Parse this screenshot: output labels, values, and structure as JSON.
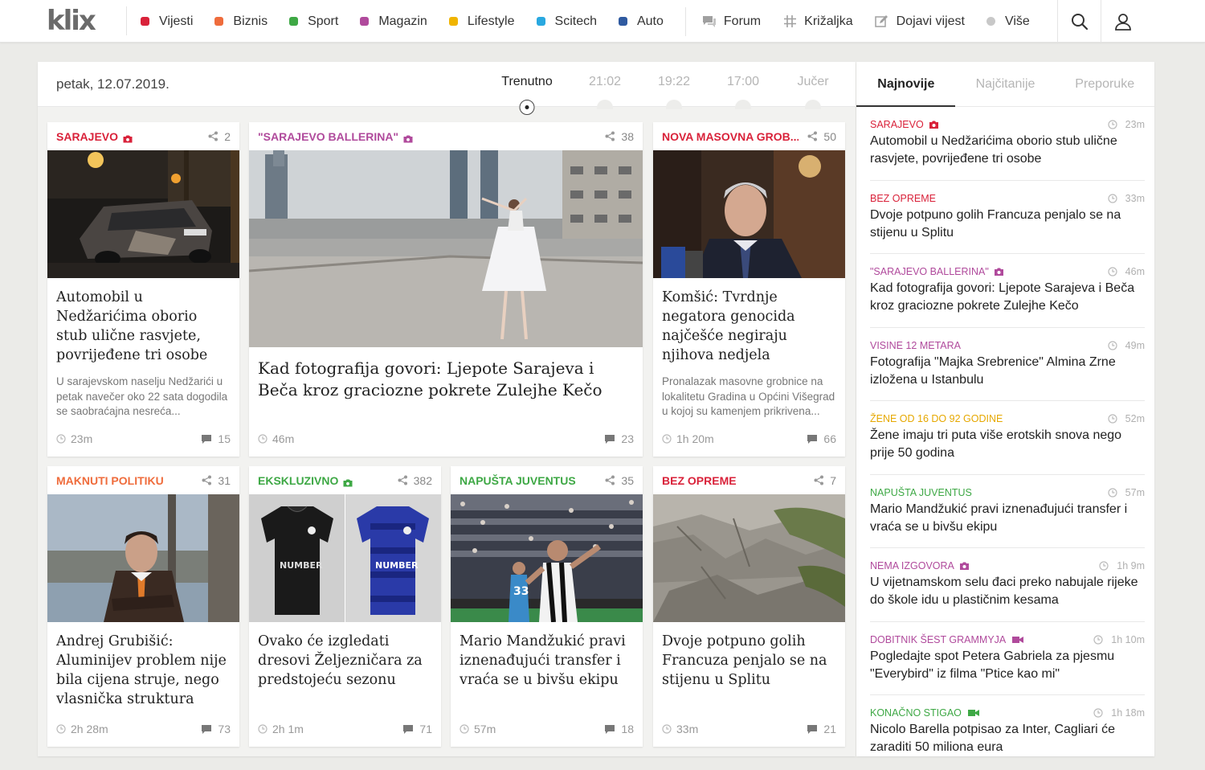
{
  "brand": {
    "name": "klix"
  },
  "nav": {
    "categories": [
      {
        "label": "Vijesti",
        "color": "#d9223a"
      },
      {
        "label": "Biznis",
        "color": "#ef6c3c"
      },
      {
        "label": "Sport",
        "color": "#3ea845"
      },
      {
        "label": "Magazin",
        "color": "#b04a9c"
      },
      {
        "label": "Lifestyle",
        "color": "#f0b400"
      },
      {
        "label": "Scitech",
        "color": "#29a8e0"
      },
      {
        "label": "Auto",
        "color": "#2f5aa0"
      }
    ],
    "forum": "Forum",
    "krizaljka": "Križaljka",
    "dojavi": "Dojavi vijest",
    "vise": "Više"
  },
  "timeline": {
    "date": "petak, 12.07.2019.",
    "items": [
      "Trenutno",
      "21:02",
      "19:22",
      "17:00",
      "Jučer"
    ]
  },
  "cards": [
    {
      "category": "SARAJEVO",
      "cat_color": "#d9223a",
      "camera": true,
      "shares": "2",
      "title": "Automobil u Nedžarićima oborio stub ulične rasvjete, povrijeđene tri osobe",
      "lead": "U sarajevskom naselju Nedžarići u petak navečer oko 22 sata dogodila se saobraćajna nesreća...",
      "time": "23m",
      "comments": "15"
    },
    {
      "category": "\"SARAJEVO BALLERINA\"",
      "cat_color": "#b04a9c",
      "camera": true,
      "shares": "38",
      "title": "Kad fotografija govori: Ljepote Sarajeva i Beča kroz graciozne pokrete Zulejhe Kečo",
      "lead": "",
      "time": "46m",
      "comments": "23"
    },
    {
      "category": "NOVA MASOVNA GROB...",
      "cat_color": "#d9223a",
      "camera": false,
      "shares": "50",
      "title": "Komšić: Tvrdnje negatora genocida najčešće negiraju njihova nedjela",
      "lead": "Pronalazak masovne grobnice na lokalitetu Gradina u Općini Višegrad u kojoj su kamenjem prikrivena...",
      "time": "1h 20m",
      "comments": "66"
    },
    {
      "category": "MAKNUTI POLITIKU",
      "cat_color": "#ef6c3c",
      "camera": false,
      "shares": "31",
      "title": "Andrej Grubišić: Aluminijev problem nije bila cijena struje, nego vlasnička struktura",
      "lead": "",
      "time": "2h 28m",
      "comments": "73"
    },
    {
      "category": "EKSKLUZIVNO",
      "cat_color": "#3ea845",
      "camera": true,
      "shares": "382",
      "title": "Ovako će izgledati dresovi Željezničara za predstojeću sezonu",
      "lead": "",
      "time": "2h 1m",
      "comments": "71"
    },
    {
      "category": "NAPUŠTA JUVENTUS",
      "cat_color": "#3ea845",
      "camera": false,
      "shares": "35",
      "title": "Mario Mandžukić pravi iznenađujući transfer i vraća se u bivšu ekipu",
      "lead": "",
      "time": "57m",
      "comments": "18"
    },
    {
      "category": "BEZ OPREME",
      "cat_color": "#d9223a",
      "camera": false,
      "shares": "7",
      "title": "Dvoje potpuno golih Francuza penjalo se na stijenu u Splitu",
      "lead": "",
      "time": "33m",
      "comments": "21"
    }
  ],
  "sidebar": {
    "tabs": [
      "Najnovije",
      "Najčitanije",
      "Preporuke"
    ],
    "items": [
      {
        "category": "SARAJEVO",
        "cat_color": "#d9223a",
        "icon": "camera",
        "time": "23m",
        "title": "Automobil u Nedžarićima oborio stub ulične rasvjete, povrijeđene tri osobe"
      },
      {
        "category": "BEZ OPREME",
        "cat_color": "#d9223a",
        "icon": "",
        "time": "33m",
        "title": "Dvoje potpuno golih Francuza penjalo se na stijenu u Splitu"
      },
      {
        "category": "\"SARAJEVO BALLERINA\"",
        "cat_color": "#b04a9c",
        "icon": "camera",
        "time": "46m",
        "title": "Kad fotografija govori: Ljepote Sarajeva i Beča kroz graciozne pokrete Zulejhe Kečo"
      },
      {
        "category": "VISINE 12 METARA",
        "cat_color": "#b04a9c",
        "icon": "",
        "time": "49m",
        "title": "Fotografija \"Majka Srebrenice\" Almina Zrne izložena u Istanbulu"
      },
      {
        "category": "ŽENE OD 16 DO 92 GODINE",
        "cat_color": "#e6a800",
        "icon": "",
        "time": "52m",
        "title": "Žene imaju tri puta više erotskih snova nego prije 50 godina"
      },
      {
        "category": "NAPUŠTA JUVENTUS",
        "cat_color": "#3ea845",
        "icon": "",
        "time": "57m",
        "title": "Mario Mandžukić pravi iznenađujući transfer i vraća se u bivšu ekipu"
      },
      {
        "category": "NEMA IZGOVORA",
        "cat_color": "#b04a9c",
        "icon": "camera",
        "time": "1h 9m",
        "title": "U vijetnamskom selu đaci preko nabujale rijeke do škole idu u plastičnim kesama"
      },
      {
        "category": "DOBITNIK ŠEST GRAMMYJA",
        "cat_color": "#b04a9c",
        "icon": "video",
        "time": "1h 10m",
        "title": "Pogledajte spot Petera Gabriela za pjesmu \"Everybird\" iz filma \"Ptice kao mi\""
      },
      {
        "category": "KONAČNO STIGAO",
        "cat_color": "#3ea845",
        "icon": "video",
        "time": "1h 18m",
        "title": "Nicolo Barella potpisao za Inter, Cagliari će zaraditi 50 miliona eura"
      }
    ]
  }
}
